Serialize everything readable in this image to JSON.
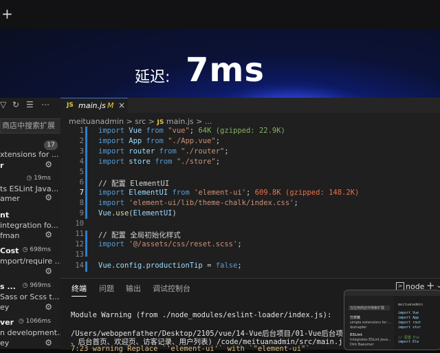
{
  "overlay": {
    "plus": "+",
    "latency_label": "延迟:",
    "latency_value": "7ms"
  },
  "sidebar": {
    "search_placeholder": "商店中搜索扩展",
    "badge": "17",
    "items": [
      {
        "title": "xtensions for ...",
        "meta": "",
        "sub": "r"
      },
      {
        "title": "",
        "meta": "19ms",
        "sub": "ts ESLint Java...",
        "sub2": "amer"
      },
      {
        "title": "nt",
        "meta": "",
        "sub": "integration fo...",
        "sub2": "fman"
      },
      {
        "title": "Cost",
        "meta": "698ms",
        "sub": "mport/require ...",
        "sub2": ""
      },
      {
        "title": "s ...",
        "meta": "969ms",
        "sub": "Sass or Scss t...",
        "sub2": "ey"
      },
      {
        "title": "ver",
        "meta": "1066ms",
        "sub": "n development...",
        "sub2": "ey"
      }
    ]
  },
  "editor": {
    "tab": {
      "name": "main.js",
      "modified": "M",
      "close": "×"
    },
    "breadcrumb": {
      "root": "meituanadmin",
      "folder": "src",
      "file": "main.js",
      "rest": "..."
    },
    "lines": [
      {
        "n": "1"
      },
      {
        "n": "2"
      },
      {
        "n": "3"
      },
      {
        "n": "4"
      },
      {
        "n": "5"
      },
      {
        "n": "6"
      },
      {
        "n": "7"
      },
      {
        "n": "8"
      },
      {
        "n": "9"
      },
      {
        "n": "10"
      },
      {
        "n": "11"
      },
      {
        "n": "12"
      },
      {
        "n": "13"
      },
      {
        "n": "14"
      }
    ],
    "code": {
      "l1_a": "import ",
      "l1_b": "Vue",
      "l1_c": " from ",
      "l1_d": "\"vue\"",
      "l1_e": ";   ",
      "l1_hint": "64K (gzipped: 22.9K)",
      "l2_b": "App",
      "l2_d": "\"./App.vue\"",
      "l3_b": "router",
      "l3_d": "\"./router\"",
      "l4_b": "store",
      "l4_d": "\"./store\"",
      "l6": "// 配置 ElementUI",
      "l7_b": "ElementUI",
      "l7_d": "'element-ui'",
      "l7_hint": "609.8K (gzipped: 148.2K)",
      "l8_d": "'element-ui/lib/theme-chalk/index.css'",
      "l9_a": "Vue",
      "l9_b": "use",
      "l9_c": "ElementUI",
      "l11": "// 配置 全局初始化样式",
      "l12_d": "'@/assets/css/reset.scss'",
      "l14_a": "Vue",
      "l14_b": "config",
      "l14_c": "productionTip",
      "l14_d": "false"
    }
  },
  "panel": {
    "tabs": [
      "终端",
      "问题",
      "输出",
      "调试控制台"
    ],
    "shell": "node",
    "terminal": [
      "Module Warning (from ./node_modules/eslint-loader/index.js):",
      "/Users/webopenfather/Desktop/2105/vue/14-Vue后台项目/01-Vue后台项目",
      "、后台首页、欢迎页、访客记录、用户列表) /code/meituanadmin/src/main.j",
      "  7:23  warning  Replace `'element-ui'` with `\"element-ui\"`"
    ]
  },
  "mini": {
    "search": "在应用商店中搜索扩展",
    "items": [
      "已安装",
      "simple extensions for ...",
      "dsznajder",
      "ESLint",
      "Integrates ESLint Java...",
      "Dirk Baeumer"
    ],
    "crumb": "meituanadmin",
    "code": [
      "import Vue",
      "import App",
      "import rout",
      "import stor",
      "// 配置 Ele",
      "import Ele"
    ]
  }
}
